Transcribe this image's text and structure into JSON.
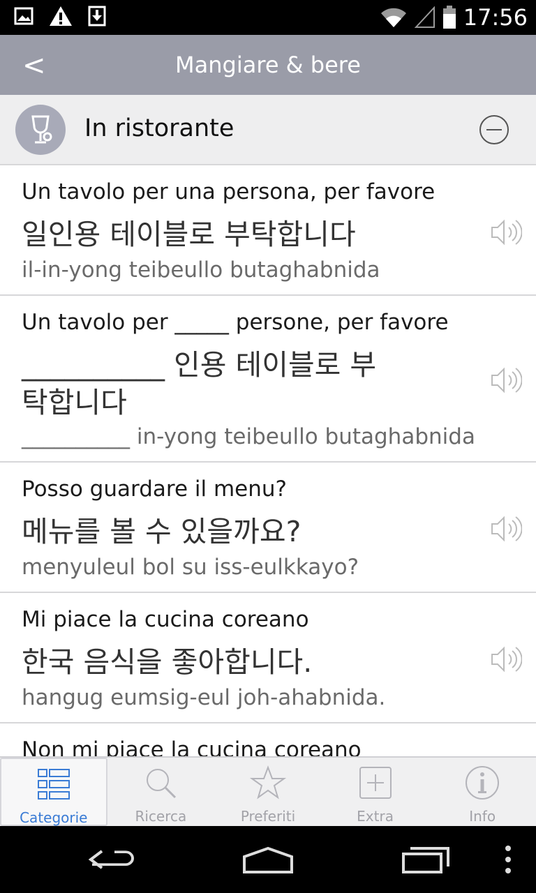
{
  "status_bar": {
    "time": "17:56",
    "left_icons": [
      "image-icon",
      "warning-icon",
      "download-icon"
    ],
    "right_icons": [
      "wifi-icon",
      "signal-icon",
      "battery-icon"
    ]
  },
  "app_bar": {
    "back_label": "<",
    "title": "Mangiare & bere"
  },
  "category": {
    "title": "In ristorante",
    "icon": "wine-glass-icon",
    "toggle_icon": "minus-circle-icon"
  },
  "phrases": [
    {
      "italian": "Un tavolo per una persona, per favore",
      "korean": "일인용 테이블로 부탁합니다",
      "romanization": "il-in-yong teibeullo butaghabnida"
    },
    {
      "italian": "Un tavolo per _____ persone, per favore",
      "korean": "__________ 인용 테이블로 부탁합니다",
      "romanization": "__________ in-yong teibeullo butaghabnida"
    },
    {
      "italian": "Posso guardare il menu?",
      "korean": "메뉴를 볼 수 있을까요?",
      "romanization": "menyuleul bol su iss-eulkkayo?"
    },
    {
      "italian": "Mi piace la cucina coreano",
      "korean": "한국 음식을 좋아합니다.",
      "romanization": "hangug eumsig-eul joh-ahabnida."
    },
    {
      "italian": "Non mi piace la cucina coreano",
      "korean": "",
      "romanization": ""
    }
  ],
  "tabs": [
    {
      "label": "Categorie",
      "icon": "list-icon",
      "active": true
    },
    {
      "label": "Ricerca",
      "icon": "search-icon",
      "active": false
    },
    {
      "label": "Preferiti",
      "icon": "star-icon",
      "active": false
    },
    {
      "label": "Extra",
      "icon": "plus-box-icon",
      "active": false
    },
    {
      "label": "Info",
      "icon": "info-icon",
      "active": false
    }
  ],
  "colors": {
    "app_bar": "#9a9ca8",
    "accent": "#3a7bd5",
    "inactive_tab": "#a2a2a8"
  }
}
